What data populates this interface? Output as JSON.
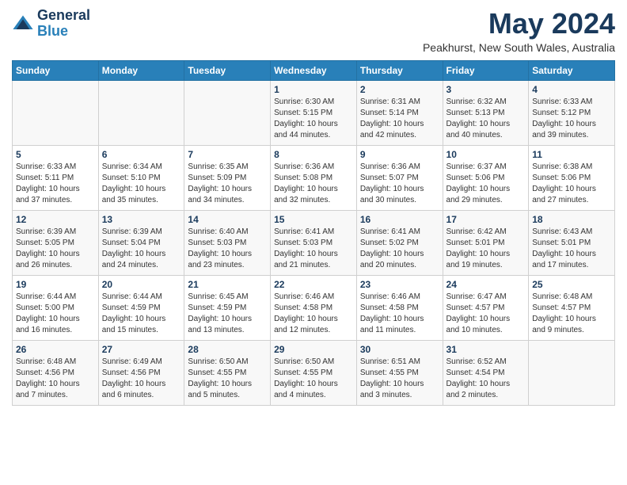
{
  "logo": {
    "line1": "General",
    "line2": "Blue"
  },
  "title": "May 2024",
  "subtitle": "Peakhurst, New South Wales, Australia",
  "days_of_week": [
    "Sunday",
    "Monday",
    "Tuesday",
    "Wednesday",
    "Thursday",
    "Friday",
    "Saturday"
  ],
  "weeks": [
    [
      {
        "day": "",
        "sunrise": "",
        "sunset": "",
        "daylight": ""
      },
      {
        "day": "",
        "sunrise": "",
        "sunset": "",
        "daylight": ""
      },
      {
        "day": "",
        "sunrise": "",
        "sunset": "",
        "daylight": ""
      },
      {
        "day": "1",
        "sunrise": "Sunrise: 6:30 AM",
        "sunset": "Sunset: 5:15 PM",
        "daylight": "Daylight: 10 hours and 44 minutes."
      },
      {
        "day": "2",
        "sunrise": "Sunrise: 6:31 AM",
        "sunset": "Sunset: 5:14 PM",
        "daylight": "Daylight: 10 hours and 42 minutes."
      },
      {
        "day": "3",
        "sunrise": "Sunrise: 6:32 AM",
        "sunset": "Sunset: 5:13 PM",
        "daylight": "Daylight: 10 hours and 40 minutes."
      },
      {
        "day": "4",
        "sunrise": "Sunrise: 6:33 AM",
        "sunset": "Sunset: 5:12 PM",
        "daylight": "Daylight: 10 hours and 39 minutes."
      }
    ],
    [
      {
        "day": "5",
        "sunrise": "Sunrise: 6:33 AM",
        "sunset": "Sunset: 5:11 PM",
        "daylight": "Daylight: 10 hours and 37 minutes."
      },
      {
        "day": "6",
        "sunrise": "Sunrise: 6:34 AM",
        "sunset": "Sunset: 5:10 PM",
        "daylight": "Daylight: 10 hours and 35 minutes."
      },
      {
        "day": "7",
        "sunrise": "Sunrise: 6:35 AM",
        "sunset": "Sunset: 5:09 PM",
        "daylight": "Daylight: 10 hours and 34 minutes."
      },
      {
        "day": "8",
        "sunrise": "Sunrise: 6:36 AM",
        "sunset": "Sunset: 5:08 PM",
        "daylight": "Daylight: 10 hours and 32 minutes."
      },
      {
        "day": "9",
        "sunrise": "Sunrise: 6:36 AM",
        "sunset": "Sunset: 5:07 PM",
        "daylight": "Daylight: 10 hours and 30 minutes."
      },
      {
        "day": "10",
        "sunrise": "Sunrise: 6:37 AM",
        "sunset": "Sunset: 5:06 PM",
        "daylight": "Daylight: 10 hours and 29 minutes."
      },
      {
        "day": "11",
        "sunrise": "Sunrise: 6:38 AM",
        "sunset": "Sunset: 5:06 PM",
        "daylight": "Daylight: 10 hours and 27 minutes."
      }
    ],
    [
      {
        "day": "12",
        "sunrise": "Sunrise: 6:39 AM",
        "sunset": "Sunset: 5:05 PM",
        "daylight": "Daylight: 10 hours and 26 minutes."
      },
      {
        "day": "13",
        "sunrise": "Sunrise: 6:39 AM",
        "sunset": "Sunset: 5:04 PM",
        "daylight": "Daylight: 10 hours and 24 minutes."
      },
      {
        "day": "14",
        "sunrise": "Sunrise: 6:40 AM",
        "sunset": "Sunset: 5:03 PM",
        "daylight": "Daylight: 10 hours and 23 minutes."
      },
      {
        "day": "15",
        "sunrise": "Sunrise: 6:41 AM",
        "sunset": "Sunset: 5:03 PM",
        "daylight": "Daylight: 10 hours and 21 minutes."
      },
      {
        "day": "16",
        "sunrise": "Sunrise: 6:41 AM",
        "sunset": "Sunset: 5:02 PM",
        "daylight": "Daylight: 10 hours and 20 minutes."
      },
      {
        "day": "17",
        "sunrise": "Sunrise: 6:42 AM",
        "sunset": "Sunset: 5:01 PM",
        "daylight": "Daylight: 10 hours and 19 minutes."
      },
      {
        "day": "18",
        "sunrise": "Sunrise: 6:43 AM",
        "sunset": "Sunset: 5:01 PM",
        "daylight": "Daylight: 10 hours and 17 minutes."
      }
    ],
    [
      {
        "day": "19",
        "sunrise": "Sunrise: 6:44 AM",
        "sunset": "Sunset: 5:00 PM",
        "daylight": "Daylight: 10 hours and 16 minutes."
      },
      {
        "day": "20",
        "sunrise": "Sunrise: 6:44 AM",
        "sunset": "Sunset: 4:59 PM",
        "daylight": "Daylight: 10 hours and 15 minutes."
      },
      {
        "day": "21",
        "sunrise": "Sunrise: 6:45 AM",
        "sunset": "Sunset: 4:59 PM",
        "daylight": "Daylight: 10 hours and 13 minutes."
      },
      {
        "day": "22",
        "sunrise": "Sunrise: 6:46 AM",
        "sunset": "Sunset: 4:58 PM",
        "daylight": "Daylight: 10 hours and 12 minutes."
      },
      {
        "day": "23",
        "sunrise": "Sunrise: 6:46 AM",
        "sunset": "Sunset: 4:58 PM",
        "daylight": "Daylight: 10 hours and 11 minutes."
      },
      {
        "day": "24",
        "sunrise": "Sunrise: 6:47 AM",
        "sunset": "Sunset: 4:57 PM",
        "daylight": "Daylight: 10 hours and 10 minutes."
      },
      {
        "day": "25",
        "sunrise": "Sunrise: 6:48 AM",
        "sunset": "Sunset: 4:57 PM",
        "daylight": "Daylight: 10 hours and 9 minutes."
      }
    ],
    [
      {
        "day": "26",
        "sunrise": "Sunrise: 6:48 AM",
        "sunset": "Sunset: 4:56 PM",
        "daylight": "Daylight: 10 hours and 7 minutes."
      },
      {
        "day": "27",
        "sunrise": "Sunrise: 6:49 AM",
        "sunset": "Sunset: 4:56 PM",
        "daylight": "Daylight: 10 hours and 6 minutes."
      },
      {
        "day": "28",
        "sunrise": "Sunrise: 6:50 AM",
        "sunset": "Sunset: 4:55 PM",
        "daylight": "Daylight: 10 hours and 5 minutes."
      },
      {
        "day": "29",
        "sunrise": "Sunrise: 6:50 AM",
        "sunset": "Sunset: 4:55 PM",
        "daylight": "Daylight: 10 hours and 4 minutes."
      },
      {
        "day": "30",
        "sunrise": "Sunrise: 6:51 AM",
        "sunset": "Sunset: 4:55 PM",
        "daylight": "Daylight: 10 hours and 3 minutes."
      },
      {
        "day": "31",
        "sunrise": "Sunrise: 6:52 AM",
        "sunset": "Sunset: 4:54 PM",
        "daylight": "Daylight: 10 hours and 2 minutes."
      },
      {
        "day": "",
        "sunrise": "",
        "sunset": "",
        "daylight": ""
      }
    ]
  ]
}
